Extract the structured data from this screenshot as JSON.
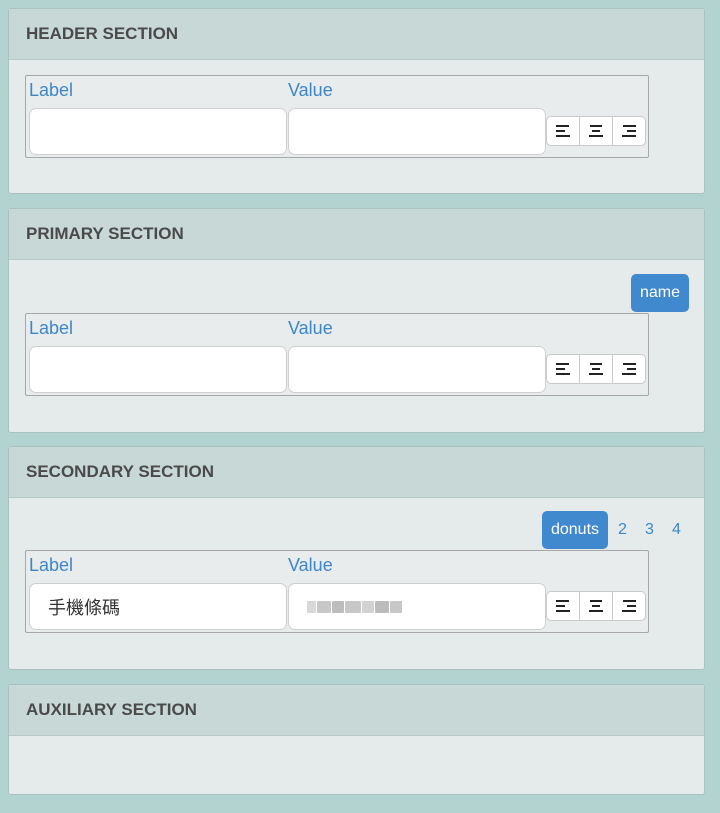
{
  "sections": [
    {
      "title": "HEADER SECTION"
    },
    {
      "title": "PRIMARY SECTION",
      "tag": "name"
    },
    {
      "title": "SECONDARY SECTION",
      "tag": "donuts",
      "pages": [
        "2",
        "3",
        "4"
      ]
    },
    {
      "title": "AUXILIARY SECTION"
    }
  ],
  "rows": [
    {
      "label_header": "Label",
      "value_header": "Value",
      "label_value": "",
      "value_value": ""
    },
    {
      "label_header": "Label",
      "value_header": "Value",
      "label_value": "",
      "value_value": ""
    },
    {
      "label_header": "Label",
      "value_header": "Value",
      "label_value": "手機條碼",
      "value_value": "(blurred)"
    }
  ],
  "align_icons": [
    "align-left-icon",
    "align-center-icon",
    "align-right-icon"
  ],
  "colors": {
    "page_bg": "#b3d3d1",
    "section_bg": "#e5ebeb",
    "header_bg": "#c7d8d6",
    "accent": "#4189cf",
    "label_text": "#3f86c7"
  }
}
